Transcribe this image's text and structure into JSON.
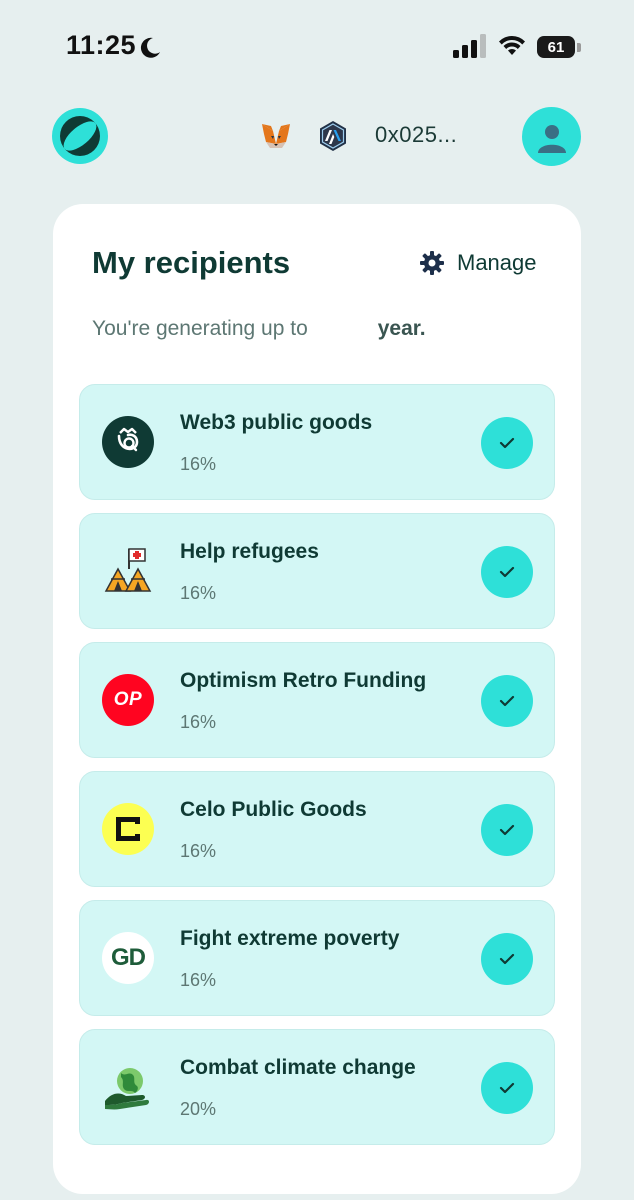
{
  "status_bar": {
    "time": "11:25",
    "battery": "61",
    "icons": [
      "moon-icon",
      "signal-icon",
      "wifi-icon",
      "battery-icon"
    ]
  },
  "header": {
    "wallet_address": "0x025...",
    "icons": [
      "app-logo-icon",
      "metamask-fox-icon",
      "arbitrum-icon",
      "user-avatar-icon"
    ]
  },
  "recipients": {
    "title": "My recipients",
    "manage_label": "Manage",
    "subtitle_start": "You're generating up to",
    "subtitle_end": "year.",
    "items": [
      {
        "name": "Web3 public goods",
        "percent": "16%",
        "icon": "web3-public-goods-icon",
        "selected": true
      },
      {
        "name": "Help refugees",
        "percent": "16%",
        "icon": "refugee-tents-icon",
        "selected": true
      },
      {
        "name": "Optimism Retro Funding",
        "percent": "16%",
        "icon": "optimism-op-icon",
        "icon_text": "OP",
        "selected": true
      },
      {
        "name": "Celo Public Goods",
        "percent": "16%",
        "icon": "celo-icon",
        "selected": true
      },
      {
        "name": "Fight extreme poverty",
        "percent": "16%",
        "icon": "gooddollar-gd-icon",
        "icon_text": "GD",
        "selected": true
      },
      {
        "name": "Combat climate change",
        "percent": "20%",
        "icon": "climate-globe-hand-icon",
        "selected": true
      }
    ]
  },
  "colors": {
    "background": "#e6efef",
    "card": "#ffffff",
    "item_background": "#d3f7f5",
    "accent": "#2ee0d8",
    "text_dark": "#0f3a34",
    "text_muted": "#5d7773",
    "optimism_red": "#ff0420",
    "celo_yellow": "#fcff52"
  }
}
